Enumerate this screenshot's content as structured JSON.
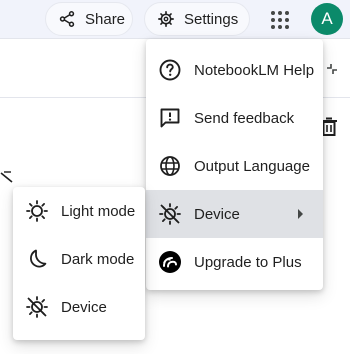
{
  "header": {
    "share_label": "Share",
    "settings_label": "Settings",
    "avatar_letter": "A",
    "avatar_color": "#0b8a6a"
  },
  "settings_menu": {
    "items": [
      {
        "label": "NotebookLM Help",
        "icon": "help-icon"
      },
      {
        "label": "Send feedback",
        "icon": "feedback-icon"
      },
      {
        "label": "Output Language",
        "icon": "globe-icon"
      },
      {
        "label": "Device",
        "icon": "device-theme-icon",
        "has_submenu": true,
        "highlighted": true
      },
      {
        "label": "Upgrade to Plus",
        "icon": "plus-logo-icon"
      }
    ]
  },
  "theme_submenu": {
    "items": [
      {
        "label": "Light mode",
        "icon": "sun-icon"
      },
      {
        "label": "Dark mode",
        "icon": "moon-icon"
      },
      {
        "label": "Device",
        "icon": "device-theme-icon"
      }
    ]
  },
  "colors": {
    "topbar_bg": "#f1f3fb",
    "highlight_bg": "#dfe1e5",
    "text": "#1f1f1f"
  }
}
